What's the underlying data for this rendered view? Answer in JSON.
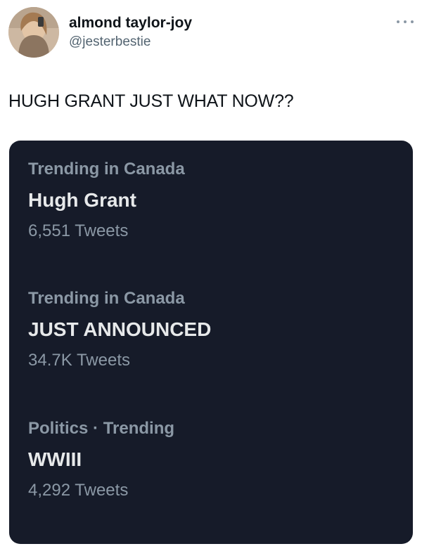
{
  "author": {
    "display_name": "almond taylor-joy",
    "handle": "@jesterbestie",
    "avatar_icon": "profile-avatar",
    "more_icon": "more-dots-icon"
  },
  "tweet": {
    "text": "HUGH GRANT JUST WHAT NOW??"
  },
  "trends": [
    {
      "context": "Trending in Canada",
      "name": "Hugh Grant",
      "count": "6,551 Tweets"
    },
    {
      "context": "Trending in Canada",
      "name": "JUST ANNOUNCED",
      "count": "34.7K Tweets"
    },
    {
      "context": "Politics · Trending",
      "name": "WWIII",
      "count": "4,292 Tweets"
    }
  ],
  "colors": {
    "card_background": "#161b29",
    "primary_text_dark": "#0f1419",
    "secondary_text": "#536471",
    "trend_context": "#8b98a5",
    "trend_name": "#e7e9ea"
  }
}
